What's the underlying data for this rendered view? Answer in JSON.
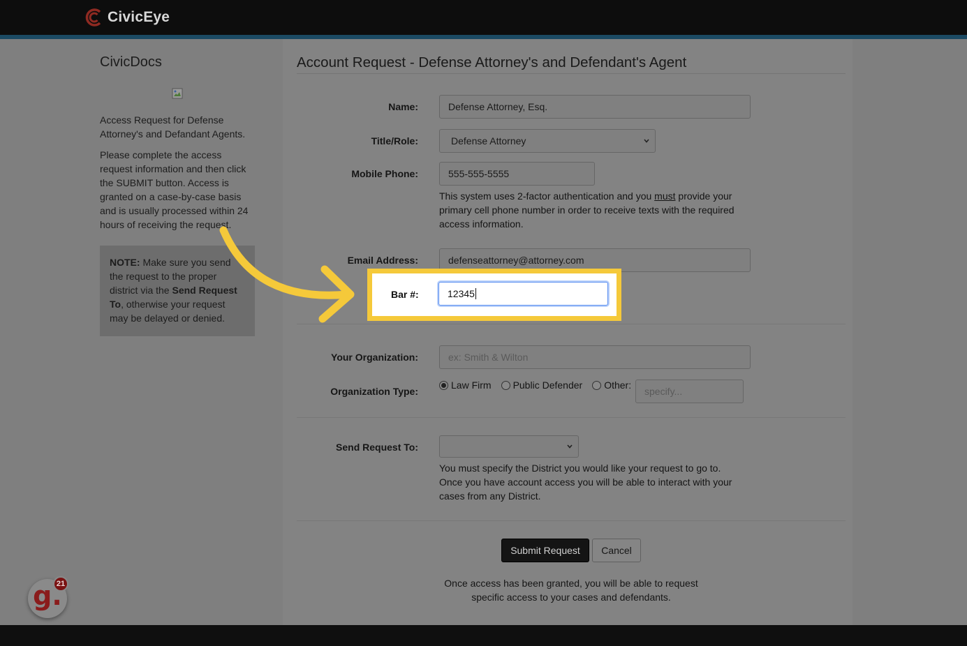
{
  "app": {
    "name": "CivicEye"
  },
  "sidebar": {
    "title": "CivicDocs",
    "intro": "Access Request for Defense Attorney's and Defandant Agents.",
    "instructions": "Please complete the access request information and then click the SUBMIT button. Access is granted on a case-by-case basis and is usually processed within 24 hours of receiving the request.",
    "note": {
      "label": "NOTE:",
      "text_1": " Make sure you send the request to the proper district via the ",
      "strong": "Send Request To",
      "text_2": ", otherwise your request may be delayed or denied."
    }
  },
  "form": {
    "title": "Account Request - Defense Attorney's and Defendant's Agent",
    "name": {
      "label": "Name:",
      "value": "Defense Attorney, Esq."
    },
    "title_role": {
      "label": "Title/Role:",
      "value": "Defense Attorney"
    },
    "mobile": {
      "label": "Mobile Phone:",
      "value": "555-555-5555",
      "help_before": "This system uses 2-factor authentication and you ",
      "help_emph": "must",
      "help_after": " provide your primary cell phone number in order to receive texts with the required access information."
    },
    "email": {
      "label": "Email Address:",
      "value": "defenseattorney@attorney.com"
    },
    "bar": {
      "label": "Bar #:",
      "value": "12345"
    },
    "organization": {
      "label": "Your Organization:",
      "placeholder": "ex: Smith & Wilton"
    },
    "org_type": {
      "label": "Organization Type:",
      "options": [
        "Law Firm",
        "Public Defender",
        "Other:"
      ],
      "selected": "Law Firm",
      "other_placeholder": "specify..."
    },
    "send_to": {
      "label": "Send Request To:",
      "value": "",
      "help": "You must specify the District you would like your request to go to. Once you have account access you will be able to interact with your cases from any District."
    },
    "submit_label": "Submit Request",
    "cancel_label": "Cancel",
    "footer": "Once access has been granted, you will be able to request specific access to your cases and defendants."
  },
  "overlay": {
    "highlight_color": "#f5c93a",
    "arrow_color": "#f5c93a"
  },
  "badge": {
    "letter": "g.",
    "count": "21",
    "color": "#8a1c1c"
  },
  "colors": {
    "topbar": "#0d0d0d",
    "accent": "#1b4a63",
    "brand_mark": "#c0392b"
  }
}
